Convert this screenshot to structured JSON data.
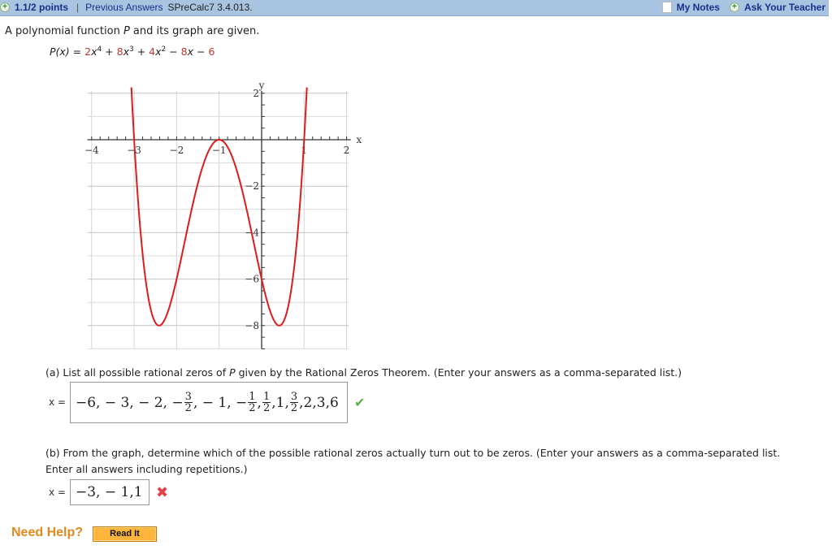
{
  "header": {
    "points": "1.1/2 points",
    "separator": "|",
    "previous_answers": "Previous Answers",
    "problem_code": "SPreCalc7 3.4.013.",
    "my_notes": "My Notes",
    "ask_teacher": "Ask Your Teacher"
  },
  "problem": {
    "intro_pre": "A polynomial function ",
    "intro_var": "P",
    "intro_post": " and its graph are given.",
    "formula": {
      "lhs": "P(x) = ",
      "c1": "2",
      "t1": "x",
      "e1": "4",
      "op1": " + ",
      "c2": "8",
      "t2": "x",
      "e2": "3",
      "op2": " + ",
      "c3": "4",
      "t3": "x",
      "e3": "2",
      "op3": " − ",
      "c4": "8",
      "t4": "x",
      "op4": " − ",
      "c5": "6"
    }
  },
  "chart_data": {
    "type": "line",
    "function": "2x^4 + 8x^3 + 4x^2 - 8x - 6",
    "xlabel": "x",
    "ylabel": "y",
    "xlim": [
      -4.1,
      2.1
    ],
    "ylim": [
      -9,
      2.4
    ],
    "x_ticks": [
      -4,
      -3,
      -2,
      -1,
      1,
      2
    ],
    "x_tick_labels": [
      "−4",
      "−3",
      "−2",
      "−1",
      "1",
      "2"
    ],
    "y_ticks": [
      2,
      -2,
      -4,
      -6,
      -8
    ],
    "y_tick_labels": [
      "2",
      "−2",
      "−4",
      "−6",
      "−8"
    ],
    "grid": true,
    "series": [
      {
        "name": "P(x)",
        "color": "#dd1c1c",
        "key_points": [
          [
            -3,
            0
          ],
          [
            -2.414,
            -8
          ],
          [
            -1,
            0
          ],
          [
            0,
            -6
          ],
          [
            0.414,
            -8
          ],
          [
            1,
            0
          ]
        ]
      }
    ]
  },
  "part_a": {
    "question_pre": "(a) List all possible rational zeros of ",
    "question_var": "P",
    "question_post": " given by the Rational Zeros Theorem. (Enter your answers as a comma-separated list.)",
    "x_label": "x =",
    "answer_parts": {
      "p1": "−6, − 3, − 2, − ",
      "f1n": "3",
      "f1d": "2",
      "p2": ", − 1, − ",
      "f2n": "1",
      "f2d": "2",
      "p3": ",",
      "f3n": "1",
      "f3d": "2",
      "p4": ",1,",
      "f4n": "3",
      "f4d": "2",
      "p5": ",2,3,6"
    },
    "status": "correct",
    "status_icon": "✔"
  },
  "part_b": {
    "question_line1": "(b) From the graph, determine which of the possible rational zeros actually turn out to be zeros. (Enter your answers as a comma-separated list.",
    "question_line2": "Enter all answers including repetitions.)",
    "x_label": "x =",
    "answer": "−3, − 1,1",
    "status": "incorrect",
    "status_icon": "✖"
  },
  "help": {
    "label": "Need Help?",
    "read_it": "Read It"
  }
}
